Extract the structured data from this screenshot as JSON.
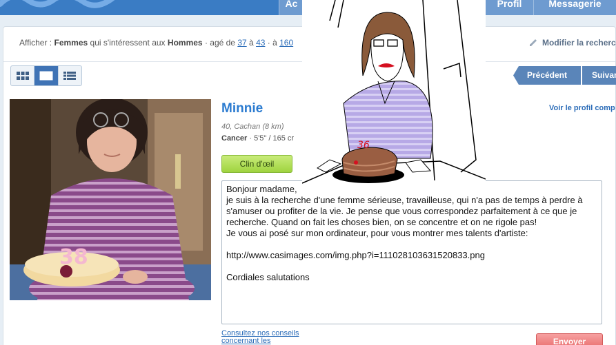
{
  "nav": {
    "tabs": [
      {
        "label": "Ac"
      },
      {
        "label": "Profil"
      },
      {
        "label": "Messagerie"
      }
    ]
  },
  "filter": {
    "prefix": "Afficher :",
    "gender": "Femmes",
    "middle": "qui s'intéressent aux",
    "target": "Hommes",
    "age_label": "· agé de",
    "age_min": "37",
    "age_sep": "à",
    "age_max": "43",
    "dist_sep": "· à",
    "distance": "160"
  },
  "edit_search_label": "Modifier la recherch",
  "pager": {
    "prev_label": "Précédent",
    "next_label": "Suivan"
  },
  "profile": {
    "name": "Minnie",
    "meta": "40, Cachan (8 km)",
    "sign": "Cancer",
    "attrs": "· 5'5\" / 165 cr",
    "see_profile": "Voir le profil comp",
    "wink_label": "Clin d'œil"
  },
  "message": {
    "text": "Bonjour madame,\nje suis à la recherche d'une femme sérieuse, travailleuse, qui n'a pas de temps à perdre à s'amuser ou profiter de la vie. Je pense que vous correspondez parfaitement à ce que je recherche. Quand on fait les choses bien, on se concentre et on ne rigole pas!\nJe vous ai posé sur mon ordinateur, pour vous montrer mes talents d'artiste:\n\nhttp://www.casimages.com/img.php?i=111028103631520833.png\n\nCordiales salutations"
  },
  "advice": {
    "line1": "Consultez nos conseils",
    "line2": "concernant les"
  },
  "send_label": "Envoyer",
  "drawing": {
    "cake_number": "36"
  },
  "photo": {
    "candle_number": "38"
  },
  "colors": {
    "nav_blue": "#3a7cc4",
    "link_blue": "#2b7bd0",
    "wink_green": "#9fd33f",
    "send_red": "#e86b6b"
  }
}
